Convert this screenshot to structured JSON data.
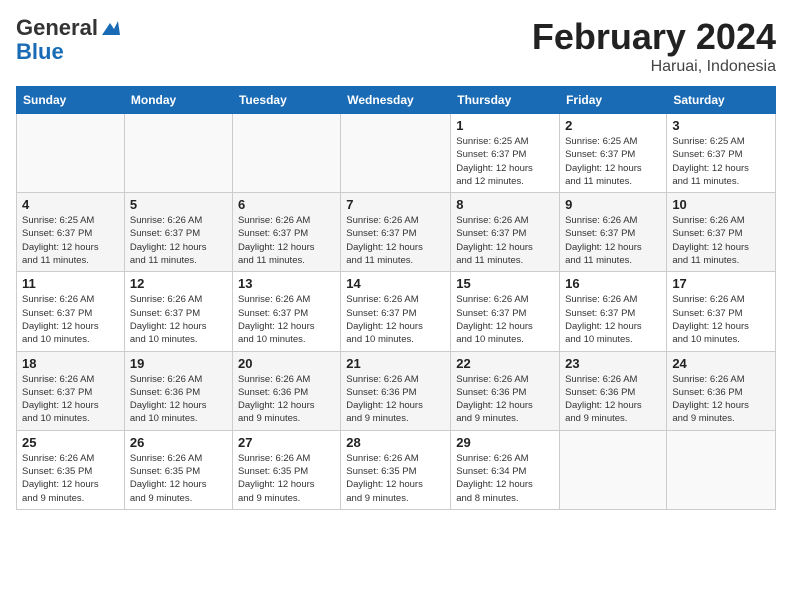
{
  "logo": {
    "line1": "General",
    "line2": "Blue"
  },
  "title": "February 2024",
  "subtitle": "Haruai, Indonesia",
  "days_of_week": [
    "Sunday",
    "Monday",
    "Tuesday",
    "Wednesday",
    "Thursday",
    "Friday",
    "Saturday"
  ],
  "weeks": [
    [
      {
        "day": "",
        "info": ""
      },
      {
        "day": "",
        "info": ""
      },
      {
        "day": "",
        "info": ""
      },
      {
        "day": "",
        "info": ""
      },
      {
        "day": "1",
        "info": "Sunrise: 6:25 AM\nSunset: 6:37 PM\nDaylight: 12 hours\nand 12 minutes."
      },
      {
        "day": "2",
        "info": "Sunrise: 6:25 AM\nSunset: 6:37 PM\nDaylight: 12 hours\nand 11 minutes."
      },
      {
        "day": "3",
        "info": "Sunrise: 6:25 AM\nSunset: 6:37 PM\nDaylight: 12 hours\nand 11 minutes."
      }
    ],
    [
      {
        "day": "4",
        "info": "Sunrise: 6:25 AM\nSunset: 6:37 PM\nDaylight: 12 hours\nand 11 minutes."
      },
      {
        "day": "5",
        "info": "Sunrise: 6:26 AM\nSunset: 6:37 PM\nDaylight: 12 hours\nand 11 minutes."
      },
      {
        "day": "6",
        "info": "Sunrise: 6:26 AM\nSunset: 6:37 PM\nDaylight: 12 hours\nand 11 minutes."
      },
      {
        "day": "7",
        "info": "Sunrise: 6:26 AM\nSunset: 6:37 PM\nDaylight: 12 hours\nand 11 minutes."
      },
      {
        "day": "8",
        "info": "Sunrise: 6:26 AM\nSunset: 6:37 PM\nDaylight: 12 hours\nand 11 minutes."
      },
      {
        "day": "9",
        "info": "Sunrise: 6:26 AM\nSunset: 6:37 PM\nDaylight: 12 hours\nand 11 minutes."
      },
      {
        "day": "10",
        "info": "Sunrise: 6:26 AM\nSunset: 6:37 PM\nDaylight: 12 hours\nand 11 minutes."
      }
    ],
    [
      {
        "day": "11",
        "info": "Sunrise: 6:26 AM\nSunset: 6:37 PM\nDaylight: 12 hours\nand 10 minutes."
      },
      {
        "day": "12",
        "info": "Sunrise: 6:26 AM\nSunset: 6:37 PM\nDaylight: 12 hours\nand 10 minutes."
      },
      {
        "day": "13",
        "info": "Sunrise: 6:26 AM\nSunset: 6:37 PM\nDaylight: 12 hours\nand 10 minutes."
      },
      {
        "day": "14",
        "info": "Sunrise: 6:26 AM\nSunset: 6:37 PM\nDaylight: 12 hours\nand 10 minutes."
      },
      {
        "day": "15",
        "info": "Sunrise: 6:26 AM\nSunset: 6:37 PM\nDaylight: 12 hours\nand 10 minutes."
      },
      {
        "day": "16",
        "info": "Sunrise: 6:26 AM\nSunset: 6:37 PM\nDaylight: 12 hours\nand 10 minutes."
      },
      {
        "day": "17",
        "info": "Sunrise: 6:26 AM\nSunset: 6:37 PM\nDaylight: 12 hours\nand 10 minutes."
      }
    ],
    [
      {
        "day": "18",
        "info": "Sunrise: 6:26 AM\nSunset: 6:37 PM\nDaylight: 12 hours\nand 10 minutes."
      },
      {
        "day": "19",
        "info": "Sunrise: 6:26 AM\nSunset: 6:36 PM\nDaylight: 12 hours\nand 10 minutes."
      },
      {
        "day": "20",
        "info": "Sunrise: 6:26 AM\nSunset: 6:36 PM\nDaylight: 12 hours\nand 9 minutes."
      },
      {
        "day": "21",
        "info": "Sunrise: 6:26 AM\nSunset: 6:36 PM\nDaylight: 12 hours\nand 9 minutes."
      },
      {
        "day": "22",
        "info": "Sunrise: 6:26 AM\nSunset: 6:36 PM\nDaylight: 12 hours\nand 9 minutes."
      },
      {
        "day": "23",
        "info": "Sunrise: 6:26 AM\nSunset: 6:36 PM\nDaylight: 12 hours\nand 9 minutes."
      },
      {
        "day": "24",
        "info": "Sunrise: 6:26 AM\nSunset: 6:36 PM\nDaylight: 12 hours\nand 9 minutes."
      }
    ],
    [
      {
        "day": "25",
        "info": "Sunrise: 6:26 AM\nSunset: 6:35 PM\nDaylight: 12 hours\nand 9 minutes."
      },
      {
        "day": "26",
        "info": "Sunrise: 6:26 AM\nSunset: 6:35 PM\nDaylight: 12 hours\nand 9 minutes."
      },
      {
        "day": "27",
        "info": "Sunrise: 6:26 AM\nSunset: 6:35 PM\nDaylight: 12 hours\nand 9 minutes."
      },
      {
        "day": "28",
        "info": "Sunrise: 6:26 AM\nSunset: 6:35 PM\nDaylight: 12 hours\nand 9 minutes."
      },
      {
        "day": "29",
        "info": "Sunrise: 6:26 AM\nSunset: 6:34 PM\nDaylight: 12 hours\nand 8 minutes."
      },
      {
        "day": "",
        "info": ""
      },
      {
        "day": "",
        "info": ""
      }
    ]
  ]
}
